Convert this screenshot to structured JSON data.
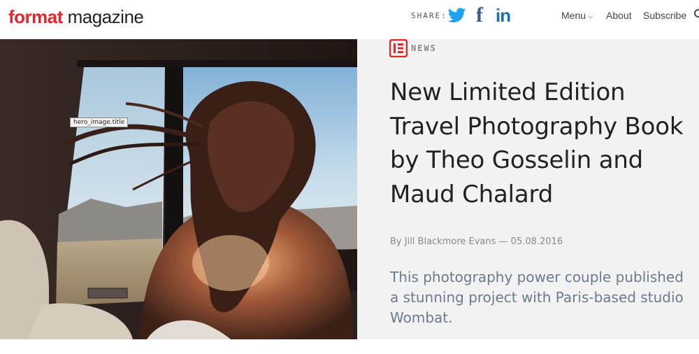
{
  "brand": {
    "name_red": "format",
    "name_dark": " magazine"
  },
  "share": {
    "label": "SHARE:",
    "twitter": "twitter-icon",
    "facebook": "f",
    "linkedin": "in"
  },
  "nav": {
    "menu": "Menu",
    "about": "About",
    "subscribe": "Subscribe"
  },
  "hero": {
    "tag": "hero_image.title"
  },
  "article": {
    "category": "NEWS",
    "title": "New Limited Edition Travel Photography Book by Theo Gosselin and Maud Chalard",
    "byline": "By Jill Blackmore Evans — 05.08.2016",
    "dek": "This photography power couple published a stunning project with Paris-based studio Wombat."
  },
  "colors": {
    "brand_red": "#e4262b",
    "twitter_blue": "#1da1f2",
    "facebook_blue": "#3b5998",
    "linkedin_blue": "#1c6fb5",
    "dek_color": "#6b7a8d",
    "panel_bg": "#f2f2f2"
  }
}
